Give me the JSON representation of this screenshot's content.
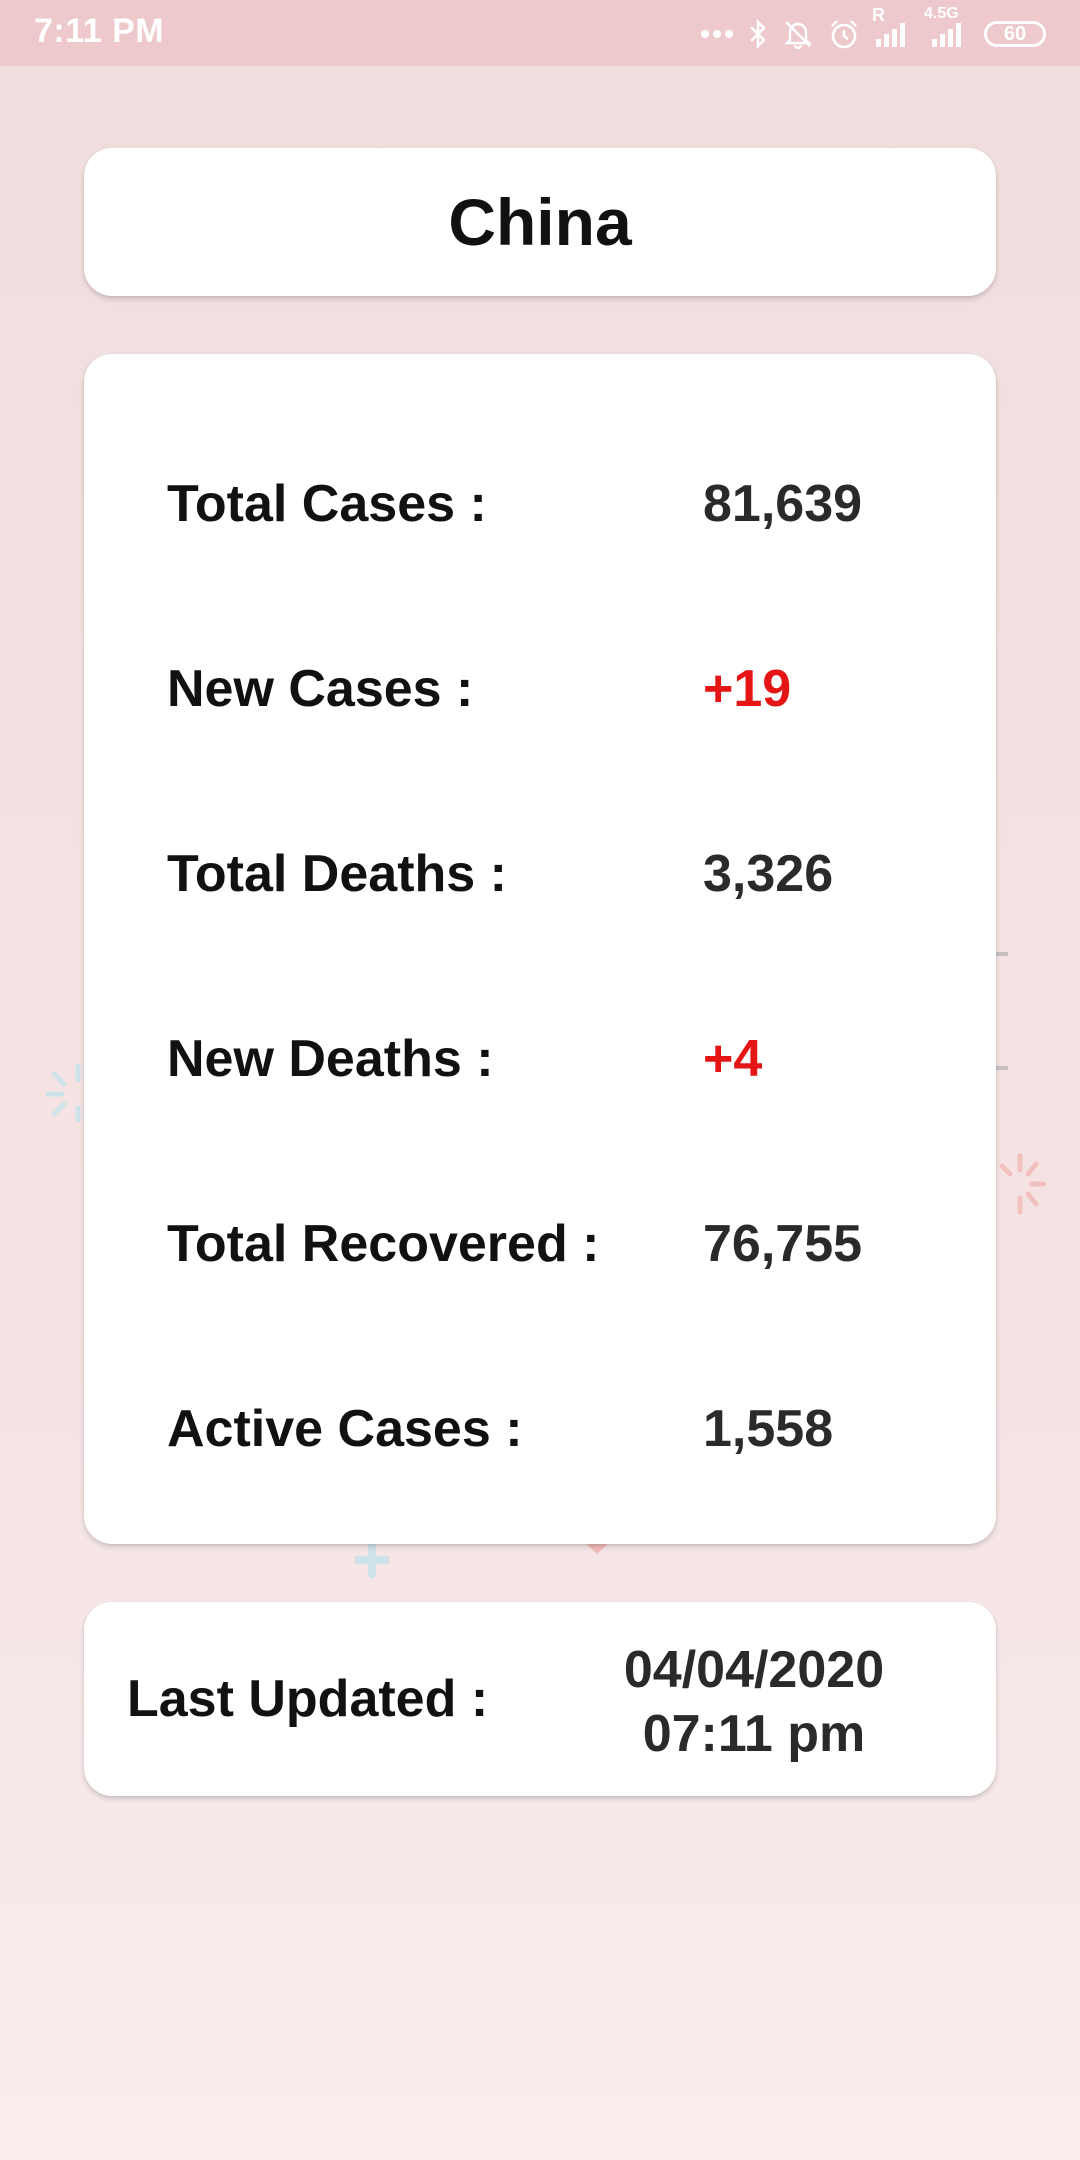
{
  "status_bar": {
    "time": "7:11 PM",
    "more_icon": "more-dots-icon",
    "bluetooth_icon": "bluetooth-icon",
    "mute_icon": "muted-bell-icon",
    "alarm_icon": "alarm-icon",
    "roaming_label": "R",
    "network_label": "4.5G",
    "battery": "60"
  },
  "country": {
    "name": "China"
  },
  "stats": {
    "total_cases_label": "Total Cases :",
    "total_cases_value": "81,639",
    "new_cases_label": "New Cases :",
    "new_cases_value": "+19",
    "total_deaths_label": "Total Deaths :",
    "total_deaths_value": "3,326",
    "new_deaths_label": "New Deaths :",
    "new_deaths_value": "+4",
    "total_recovered_label": "Total Recovered :",
    "total_recovered_value": "76,755",
    "active_cases_label": "Active Cases :",
    "active_cases_value": "1,558"
  },
  "last_updated": {
    "label": "Last Updated :",
    "date": "04/04/2020",
    "time": "07:11 pm"
  },
  "colors": {
    "status_bar_bg": "#eec9cb",
    "page_bg": "#f4e2e3",
    "card_bg": "#ffffff",
    "increase_red": "#e51515"
  }
}
